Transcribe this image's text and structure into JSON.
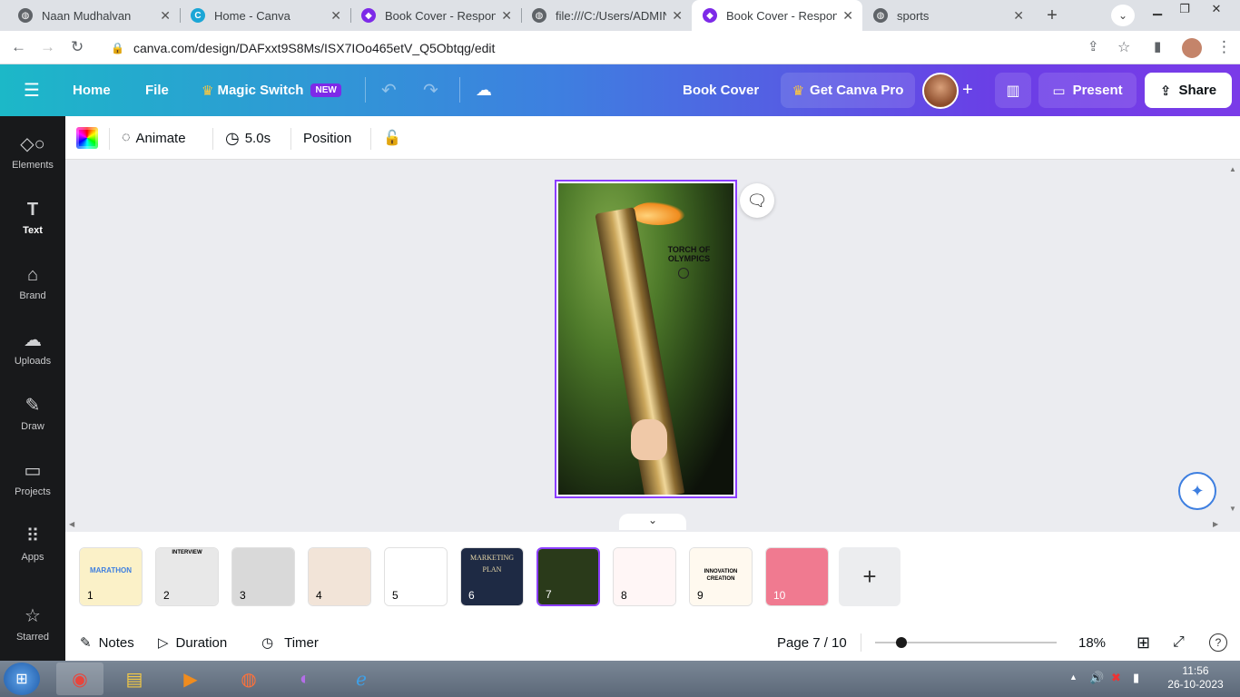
{
  "browser": {
    "tabs": [
      {
        "title": "Naan Mudhalvan",
        "favicon": "globe-icon",
        "active": false
      },
      {
        "title": "Home - Canva",
        "favicon": "canva-icon",
        "active": false
      },
      {
        "title": "Book Cover - Responsiv",
        "favicon": "canva-design-icon",
        "active": false
      },
      {
        "title": "file:///C:/Users/ADMIN/",
        "favicon": "globe-icon",
        "active": false
      },
      {
        "title": "Book Cover - Responsiv",
        "favicon": "canva-design-icon",
        "active": true
      },
      {
        "title": "sports",
        "favicon": "globe-icon",
        "active": false
      }
    ],
    "url": "canva.com/design/DAFxxt9S8Ms/ISX7IOo465etV_Q5Obtqg/edit"
  },
  "header": {
    "home": "Home",
    "file": "File",
    "magic_switch": "Magic Switch",
    "new_badge": "NEW",
    "doc_title": "Book Cover",
    "get_pro": "Get Canva Pro",
    "present": "Present",
    "share": "Share"
  },
  "sidebar": {
    "items": [
      {
        "label": "Elements",
        "icon": "elements-icon"
      },
      {
        "label": "Text",
        "icon": "text-icon"
      },
      {
        "label": "Brand",
        "icon": "brand-icon"
      },
      {
        "label": "Uploads",
        "icon": "uploads-icon"
      },
      {
        "label": "Draw",
        "icon": "draw-icon"
      },
      {
        "label": "Projects",
        "icon": "projects-icon"
      },
      {
        "label": "Apps",
        "icon": "apps-icon"
      },
      {
        "label": "Starred",
        "icon": "star-icon"
      }
    ]
  },
  "toolbar": {
    "animate": "Animate",
    "duration": "5.0s",
    "position": "Position"
  },
  "design": {
    "title_line1": "TORCH OF",
    "title_line2": "OLYMPICS"
  },
  "pages": {
    "thumbs": [
      {
        "num": "1",
        "label": "MARATHON",
        "bg": "#fbf1c8"
      },
      {
        "num": "2",
        "label": "INTERVIEW",
        "bg": "#e8e8e8"
      },
      {
        "num": "3",
        "label": "",
        "bg": "#d9d9d9"
      },
      {
        "num": "4",
        "label": "",
        "bg": "#f2e4d8"
      },
      {
        "num": "5",
        "label": "",
        "bg": "#ffffff"
      },
      {
        "num": "6",
        "label": "MARKETING PLAN",
        "bg": "#1e2a44"
      },
      {
        "num": "7",
        "label": "",
        "bg": "#2a3a1a"
      },
      {
        "num": "8",
        "label": "",
        "bg": "#fff6f6"
      },
      {
        "num": "9",
        "label": "INNOVATION CREATION",
        "bg": "#fff9ef"
      },
      {
        "num": "10",
        "label": "",
        "bg": "#f07a90"
      }
    ],
    "selected": 7
  },
  "footer": {
    "notes": "Notes",
    "duration": "Duration",
    "timer": "Timer",
    "page_indicator": "Page 7 / 10",
    "zoom": "18%",
    "zoom_fraction": 0.18
  },
  "taskbar": {
    "time": "11:56",
    "date": "26-10-2023"
  },
  "colors": {
    "accent": "#8b3dff",
    "sidebar_bg": "#18191b",
    "header_start": "#1cb8c8",
    "header_end": "#7a3be8"
  }
}
